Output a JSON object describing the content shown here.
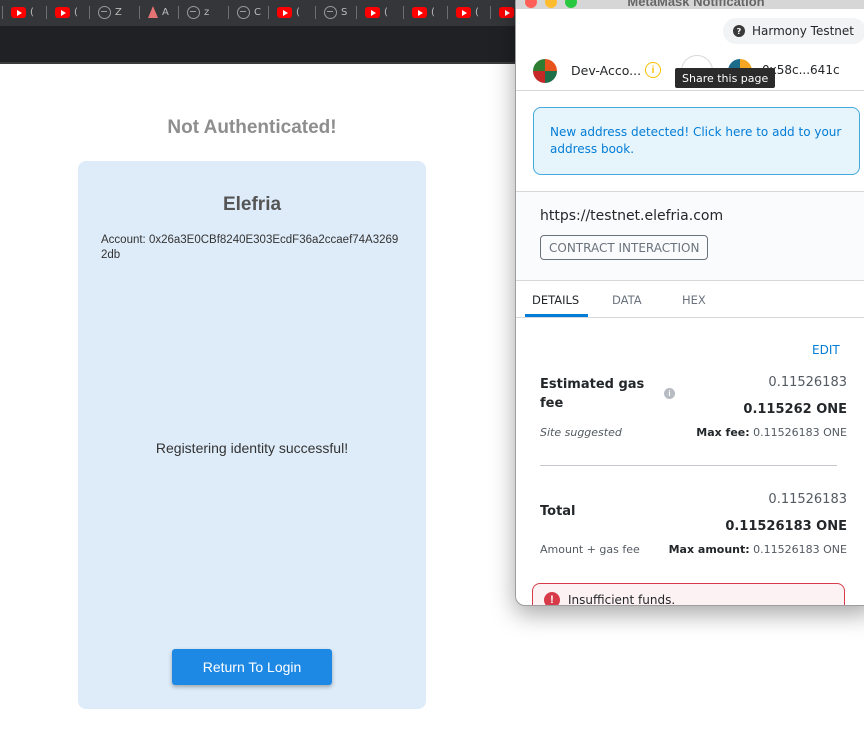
{
  "browser": {
    "tabs": [
      {
        "icon": "youtube-icon",
        "label": "("
      },
      {
        "icon": "youtube-icon",
        "label": "("
      },
      {
        "icon": "globe-icon",
        "label": "Z"
      },
      {
        "icon": "ethereum-icon",
        "label": "A"
      },
      {
        "icon": "globe-icon",
        "label": "z"
      },
      {
        "icon": "globe-icon",
        "label": "C"
      },
      {
        "icon": "youtube-icon",
        "label": "("
      },
      {
        "icon": "globe-icon",
        "label": "S"
      },
      {
        "icon": "youtube-icon",
        "label": "("
      },
      {
        "icon": "youtube-icon",
        "label": "("
      },
      {
        "icon": "youtube-icon",
        "label": "("
      },
      {
        "icon": "youtube-icon",
        "label": "("
      }
    ]
  },
  "page": {
    "title": "Not Authenticated!",
    "card": {
      "title": "Elefria",
      "account_line": "Account: 0x26a3E0CBf8240E303EcdF36a2ccaef74A32692db",
      "status": "Registering identity successful!",
      "button_label": "Return To Login"
    }
  },
  "metamask": {
    "window_title": "MetaMask Notification",
    "network": "Harmony Testnet",
    "network_icon": "?",
    "from_account": "Dev-Acco...",
    "to_account": "0x58c...641c",
    "tooltip": "Share this page",
    "notice": "New address detected! Click here to add to your address book.",
    "origin": "https://testnet.elefria.com",
    "badge": "CONTRACT INTERACTION",
    "tabs": [
      "DETAILS",
      "DATA",
      "HEX"
    ],
    "active_tab": "DETAILS",
    "edit_label": "EDIT",
    "gas": {
      "label": "Estimated gas fee",
      "value_secondary": "0.11526183",
      "value_primary": "0.115262 ONE",
      "subtitle": "Site suggested",
      "max_label": "Max fee:",
      "max_value": "0.11526183 ONE"
    },
    "total": {
      "label": "Total",
      "value_secondary": "0.11526183",
      "value_primary": "0.11526183 ONE",
      "subtitle": "Amount + gas fee",
      "max_label": "Max amount:",
      "max_value": "0.11526183 ONE"
    },
    "error": "Insufficient funds.",
    "colors": {
      "accent": "#037dd6",
      "error": "#d73a49",
      "warning": "#f8c000"
    }
  }
}
